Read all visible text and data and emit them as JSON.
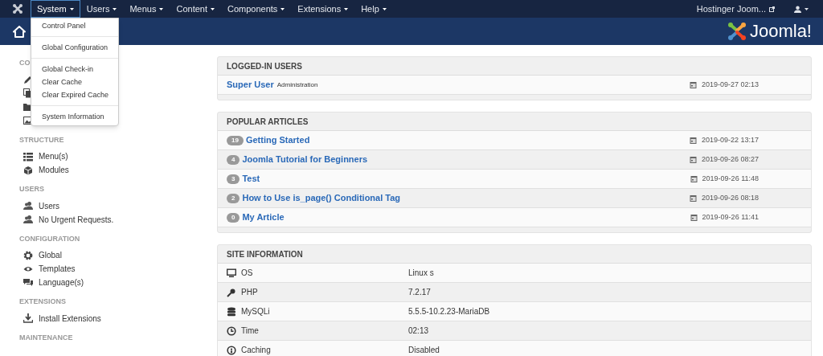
{
  "top_menu": [
    {
      "label": "System",
      "selected": true
    },
    {
      "label": "Users",
      "selected": false
    },
    {
      "label": "Menus",
      "selected": false
    },
    {
      "label": "Content",
      "selected": false
    },
    {
      "label": "Components",
      "selected": false
    },
    {
      "label": "Extensions",
      "selected": false
    },
    {
      "label": "Help",
      "selected": false
    }
  ],
  "site_link": "Hostinger Joom...",
  "logo_text": "Joomla!",
  "dropdown": [
    {
      "label": "Control Panel",
      "divider_before": false
    },
    {
      "label": "Global Configuration",
      "divider_before": true
    },
    {
      "label": "Global Check-in",
      "divider_before": true
    },
    {
      "label": "Clear Cache",
      "divider_before": false
    },
    {
      "label": "Clear Expired Cache",
      "divider_before": false
    },
    {
      "label": "System Information",
      "divider_before": true
    }
  ],
  "sidebar": [
    {
      "heading": "CO",
      "kind": "covered"
    },
    {
      "heading": "STRUCTURE",
      "kind": "list",
      "items": [
        {
          "label": "Menu(s)"
        },
        {
          "label": "Modules"
        }
      ]
    },
    {
      "heading": "USERS",
      "kind": "list",
      "items": [
        {
          "label": "Users"
        },
        {
          "label": "No Urgent Requests."
        }
      ]
    },
    {
      "heading": "CONFIGURATION",
      "kind": "list",
      "items": [
        {
          "label": "Global"
        },
        {
          "label": "Templates"
        },
        {
          "label": "Language(s)"
        }
      ]
    },
    {
      "heading": "EXTENSIONS",
      "kind": "list",
      "items": [
        {
          "label": "Install Extensions"
        }
      ]
    },
    {
      "heading": "MAINTENANCE",
      "kind": "list"
    }
  ],
  "logged_in_users": {
    "title": "LOGGED-IN USERS",
    "rows": [
      {
        "name": "Super User",
        "area": "Administration",
        "date": "2019-09-27 02:13"
      }
    ]
  },
  "popular_articles": {
    "title": "POPULAR ARTICLES",
    "rows": [
      {
        "hits": "19",
        "title": "Getting Started",
        "date": "2019-09-22 13:17"
      },
      {
        "hits": "4",
        "title": "Joomla Tutorial for Beginners",
        "date": "2019-09-26 08:27"
      },
      {
        "hits": "3",
        "title": "Test",
        "date": "2019-09-26 11:48"
      },
      {
        "hits": "2",
        "title": "How to Use is_page() Conditional Tag",
        "date": "2019-09-26 08:18"
      },
      {
        "hits": "0",
        "title": "My Article",
        "date": "2019-09-26 11:41"
      }
    ]
  },
  "site_information": {
    "title": "SITE INFORMATION",
    "rows": [
      {
        "label": "OS",
        "value": "Linux s"
      },
      {
        "label": "PHP",
        "value": "7.2.17"
      },
      {
        "label": "MySQLi",
        "value": "5.5.5-10.2.23-MariaDB"
      },
      {
        "label": "Time",
        "value": "02:13"
      },
      {
        "label": "Caching",
        "value": "Disabled"
      }
    ]
  }
}
